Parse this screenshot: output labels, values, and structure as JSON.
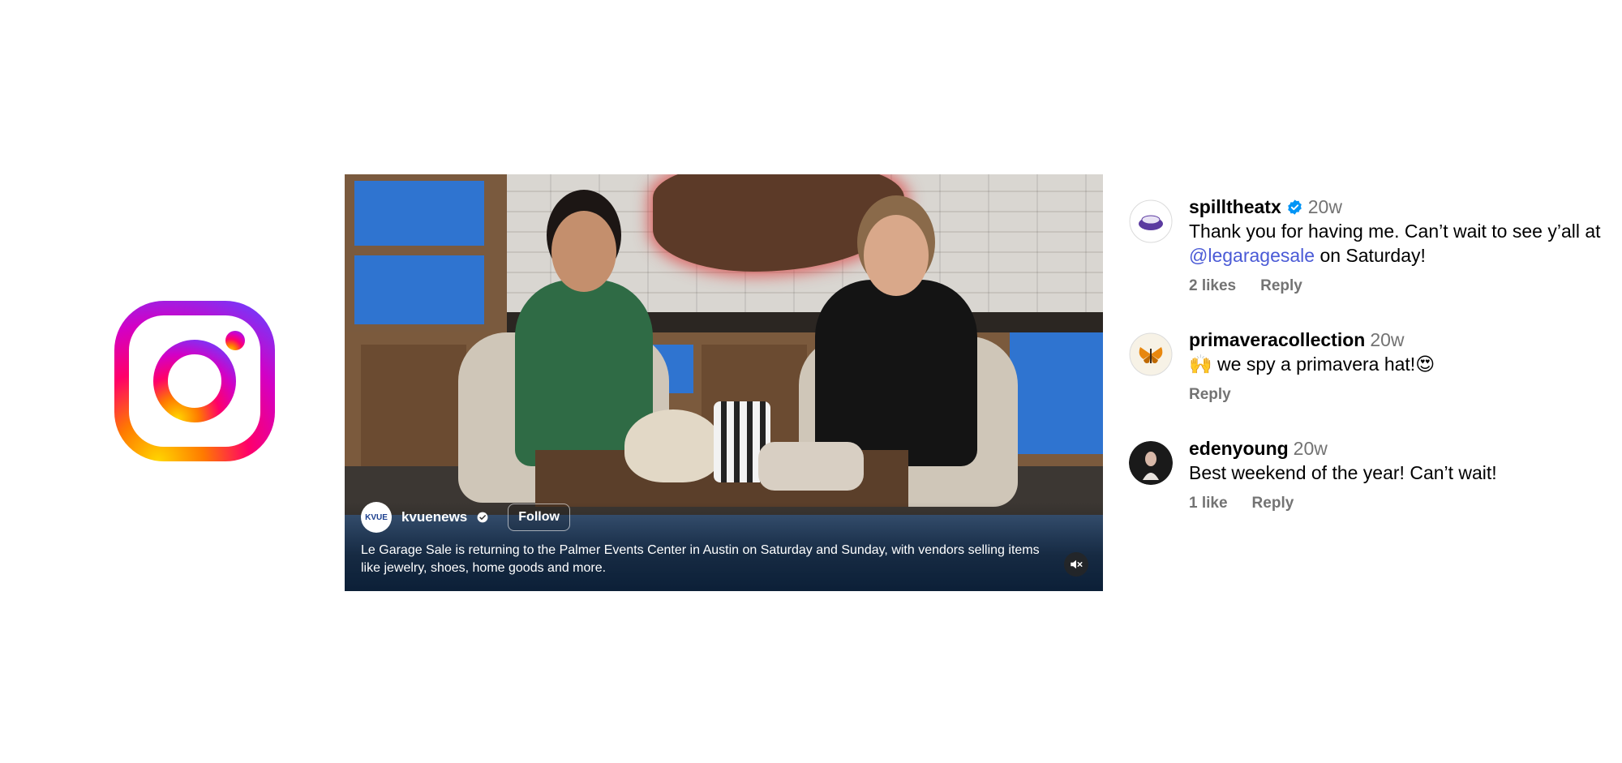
{
  "brand": {
    "logo_icon": "instagram-logo"
  },
  "video": {
    "account": {
      "avatar_text": "KVUE",
      "username": "kvuenews",
      "verified": true,
      "follow_label": "Follow"
    },
    "caption": "Le Garage Sale is returning to the Palmer Events Center in Austin on Saturday and Sunday, with vendors selling items like jewelry, shoes, home goods and more.",
    "mute_icon": "speaker-muted-icon"
  },
  "comments": [
    {
      "username": "spilltheatx",
      "verified": true,
      "time": "20w",
      "text_before": "Thank you for having me. Can’t wait to see y’all at ",
      "mention": "@legaragesale",
      "text_after": " on Saturday!",
      "likes": "2 likes",
      "reply": "Reply"
    },
    {
      "username": "primaveracollection",
      "time": "20w",
      "text": "🙌 we spy a primavera hat!😍",
      "reply": "Reply"
    },
    {
      "username": "edenyoung",
      "time": "20w",
      "text": "Best weekend of the year! Can’t wait!",
      "likes": "1 like",
      "reply": "Reply"
    }
  ]
}
